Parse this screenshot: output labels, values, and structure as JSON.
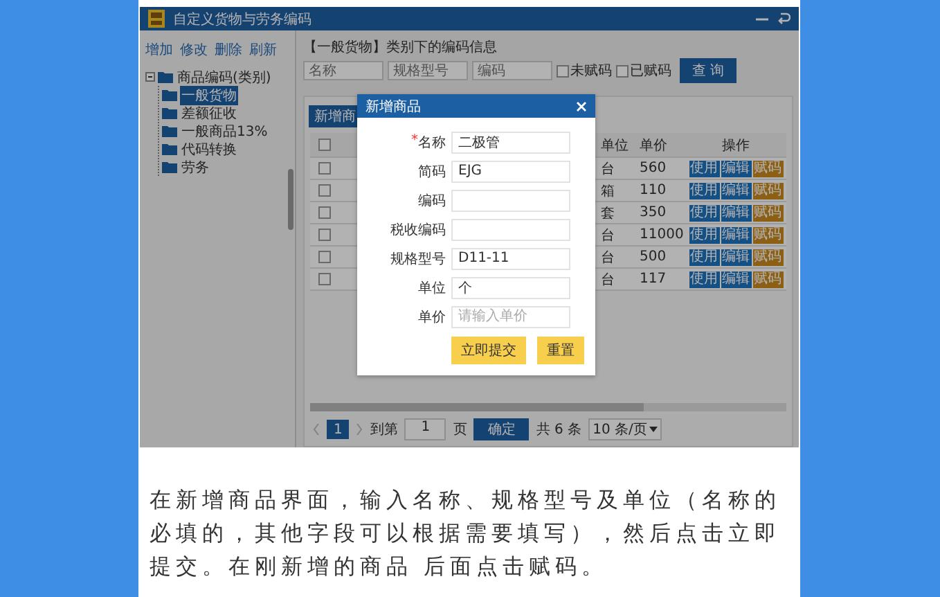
{
  "window": {
    "title": "自定义货物与劳务编码"
  },
  "sidebar": {
    "toolbar": [
      "增加",
      "修改",
      "删除",
      "刷新"
    ],
    "tree": [
      {
        "label": "商品编码(类别)",
        "expanded": true,
        "selected": false,
        "children": [
          {
            "label": "一般货物",
            "selected": true
          },
          {
            "label": "差额征收",
            "selected": false
          },
          {
            "label": "一般商品13%",
            "selected": false
          },
          {
            "label": "代码转换",
            "selected": false
          },
          {
            "label": "劳务",
            "selected": false
          }
        ]
      }
    ]
  },
  "main": {
    "heading": "【一般货物】类别下的编码信息",
    "search": [
      {
        "placeholder": "名称"
      },
      {
        "placeholder": "规格型号"
      },
      {
        "placeholder": "编码"
      }
    ],
    "filters": [
      {
        "label": "未赋码",
        "checked": false
      },
      {
        "label": "已赋码",
        "checked": false
      }
    ],
    "search_button": "查 询",
    "table_toolbar": [
      "新增商"
    ],
    "table": {
      "select_all_checked": false,
      "columns": [
        "单位",
        "单价",
        "操作"
      ],
      "rows": [
        {
          "checked": false,
          "unit": "台",
          "price": "560",
          "actions": [
            {
              "label": "使用",
              "kind": "primary"
            },
            {
              "label": "编辑",
              "kind": "primary"
            },
            {
              "label": "赋码",
              "kind": "warning"
            }
          ]
        },
        {
          "checked": false,
          "unit": "箱",
          "price": "110",
          "actions": [
            {
              "label": "使用",
              "kind": "primary"
            },
            {
              "label": "编辑",
              "kind": "primary"
            },
            {
              "label": "赋码",
              "kind": "warning"
            }
          ]
        },
        {
          "checked": false,
          "unit": "套",
          "price": "350",
          "actions": [
            {
              "label": "使用",
              "kind": "primary"
            },
            {
              "label": "编辑",
              "kind": "primary"
            },
            {
              "label": "赋码",
              "kind": "warning"
            }
          ]
        },
        {
          "checked": false,
          "unit": "台",
          "price": "11000",
          "actions": [
            {
              "label": "使用",
              "kind": "primary"
            },
            {
              "label": "编辑",
              "kind": "primary"
            },
            {
              "label": "赋码",
              "kind": "warning"
            }
          ]
        },
        {
          "checked": false,
          "unit": "台",
          "price": "500",
          "actions": [
            {
              "label": "使用",
              "kind": "primary"
            },
            {
              "label": "编辑",
              "kind": "primary"
            },
            {
              "label": "赋码",
              "kind": "warning"
            }
          ]
        },
        {
          "checked": false,
          "unit": "台",
          "price": "117",
          "actions": [
            {
              "label": "使用",
              "kind": "primary"
            },
            {
              "label": "编辑",
              "kind": "primary"
            },
            {
              "label": "赋码",
              "kind": "warning"
            }
          ]
        }
      ]
    },
    "pagination": {
      "pages": [
        {
          "label": "1",
          "selected": true
        }
      ],
      "goto_label": "到第",
      "goto_value": "1",
      "page_label": "页",
      "confirm": "确定",
      "total": "共 6 条",
      "page_size": "10 条/页"
    }
  },
  "dialog": {
    "title": "新增商品",
    "required_mark": "*",
    "fields": [
      {
        "label": "名称",
        "required": true,
        "value": "二极管"
      },
      {
        "label": "简码",
        "required": false,
        "value": "EJG"
      },
      {
        "label": "编码",
        "required": false
      },
      {
        "label": "税收编码",
        "required": false
      },
      {
        "label": "规格型号",
        "required": false,
        "value": "D11-11"
      },
      {
        "label": "单位",
        "required": false,
        "value": "个"
      },
      {
        "label": "单价",
        "required": false,
        "placeholder": "请输入单价"
      }
    ],
    "buttons": [
      "立即提交",
      "重置"
    ]
  },
  "caption": "在新增商品界面，输入名称、规格型号及单位（名称的必填的，其他字段可以根据需要填写），然后点击立即提交。在刚新增的商品 后面点击赋码。"
}
